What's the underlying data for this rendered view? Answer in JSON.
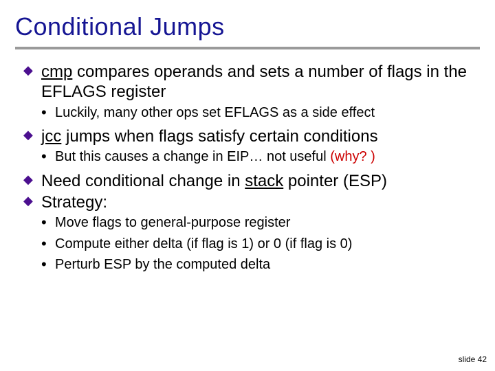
{
  "title": "Conditional Jumps",
  "b1": {
    "kw": "cmp",
    "rest": " compares operands and sets a number of flags in the EFLAGS register",
    "sub": "Luckily, many other ops set EFLAGS as a side effect"
  },
  "b2": {
    "kw": "jcc",
    "rest": " jumps when flags satisfy certain conditions",
    "sub_a": "But this causes a change in EIP… not useful ",
    "sub_b": "(why? )"
  },
  "b3": {
    "pre": "Need conditional change in ",
    "ul": "stack",
    "post": " pointer (ESP)"
  },
  "b4": {
    "text": "Strategy:",
    "s1": "Move flags to general-purpose register",
    "s2": "Compute either delta (if flag is 1) or 0 (if flag is 0)",
    "s3": "Perturb ESP by the computed delta"
  },
  "footer": "slide 42"
}
